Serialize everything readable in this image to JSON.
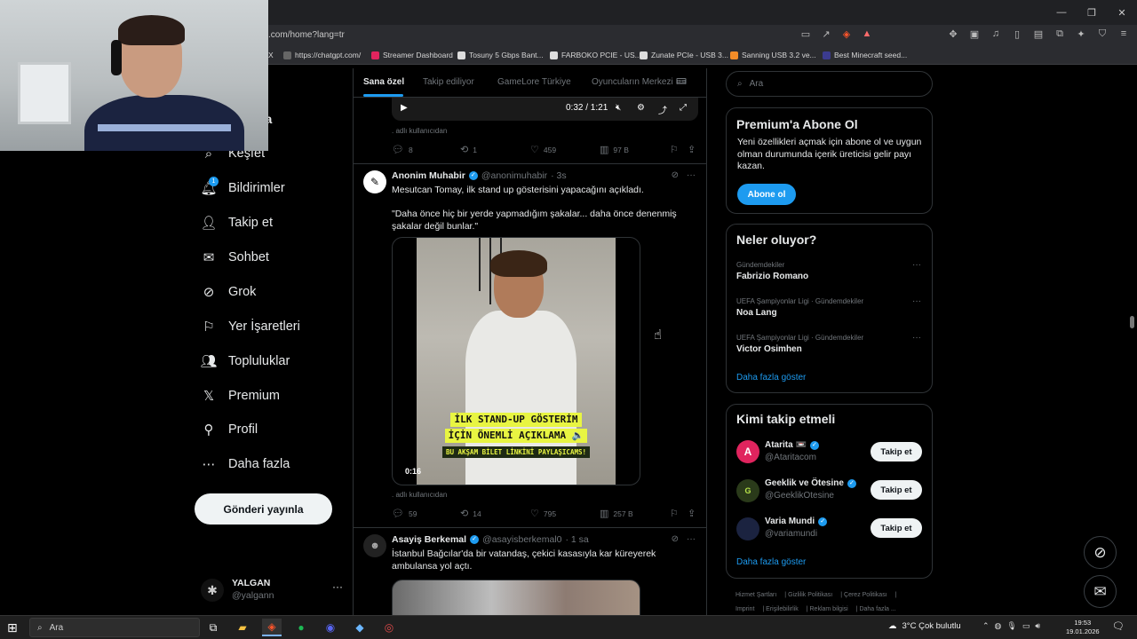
{
  "browser": {
    "url": ".com/home?lang=tr",
    "bookmarks": [
      "X",
      "https://chatgpt.com/",
      "Streamer Dashboard",
      "Tosuny 5 Gbps Bant...",
      "FARBOKO PCIE - US...",
      "Zunate PCIe - USB 3...",
      "Sanning USB 3.2 ve...",
      "Best Minecraft seed..."
    ]
  },
  "nav": {
    "partial_label": "yfa",
    "items": [
      {
        "label": "Keşfet",
        "icon": "search-icon"
      },
      {
        "label": "Bildirimler",
        "icon": "bell-icon",
        "badge": "1"
      },
      {
        "label": "Takip et",
        "icon": "person-add-icon"
      },
      {
        "label": "Sohbet",
        "icon": "mail-icon"
      },
      {
        "label": "Grok",
        "icon": "grok-icon"
      },
      {
        "label": "Yer İşaretleri",
        "icon": "bookmark-icon"
      },
      {
        "label": "Topluluklar",
        "icon": "people-icon"
      },
      {
        "label": "Premium",
        "icon": "x-logo-icon"
      },
      {
        "label": "Profil",
        "icon": "person-icon"
      },
      {
        "label": "Daha fazla",
        "icon": "more-circle-icon"
      }
    ],
    "post_button": "Gönderi yayınla",
    "account": {
      "name": "YALGAN",
      "handle": "@yalgann"
    }
  },
  "tabs": [
    "Sana özel",
    "Takip ediliyor",
    "GameLore Türkiye",
    "Oyuncuların Merkezi"
  ],
  "feed": {
    "top_video": {
      "time": "0:32 / 1:21"
    },
    "top_note": ". adlı kullanıcıdan",
    "top_actions": {
      "replies": "8",
      "reposts": "1",
      "likes": "459",
      "views": "97 B"
    },
    "tweet1": {
      "name": "Anonim Muhabir",
      "handle": "@anonimuhabir",
      "time": "· 3s",
      "text1": "Mesutcan Tomay, ilk stand up gösterisini yapacağını açıkladı.",
      "text2": "\"Daha önce hiç bir yerde yapmadığım şakalar... daha önce denenmiş şakalar değil bunlar.\"",
      "overlay_line1": "İLK STAND-UP GÖSTERİM",
      "overlay_line2": "İÇİN ÖNEMLİ AÇIKLAMA 🔈",
      "overlay_sub": "BU AKŞAM BİLET LİNKİNİ PAYLAŞICAMS!",
      "video_time": "0:16",
      "note": ". adlı kullanıcıdan",
      "actions": {
        "replies": "59",
        "reposts": "14",
        "likes": "795",
        "views": "257 B"
      }
    },
    "tweet2": {
      "name": "Asayiş Berkemal",
      "handle": "@asayisberkemal0",
      "time": "· 1 sa",
      "text": "İstanbul Bağcılar'da bir vatandaş, çekici kasasıyla kar küreyerek ambulansa yol açtı."
    }
  },
  "right": {
    "search_placeholder": "Ara",
    "premium": {
      "title": "Premium'a Abone Ol",
      "body": "Yeni özellikleri açmak için abone ol ve uygun olman durumunda içerik üreticisi gelir payı kazan.",
      "button": "Abone ol"
    },
    "trends": {
      "title": "Neler oluyor?",
      "items": [
        {
          "context": "Gündemdekiler",
          "name": "Fabrizio Romano"
        },
        {
          "context": "UEFA Şampiyonlar Ligi · Gündemdekiler",
          "name": "Noa Lang"
        },
        {
          "context": "UEFA Şampiyonlar Ligi · Gündemdekiler",
          "name": "Victor Osimhen"
        }
      ],
      "show_more": "Daha fazla göster"
    },
    "who_to_follow": {
      "title": "Kimi takip etmeli",
      "items": [
        {
          "name": "Atarita 📼",
          "handle": "@Ataritacom",
          "button": "Takip et",
          "color": "#e0245e"
        },
        {
          "name": "Geeklik ve Ötesine",
          "handle": "@GeeklikOtesine",
          "button": "Takip et",
          "color": "#2a3a1a"
        },
        {
          "name": "Varia Mundi",
          "handle": "@variamundi",
          "button": "Takip et",
          "color": "#1b2340"
        }
      ],
      "show_more": "Daha fazla göster"
    },
    "footer": [
      "Hizmet Şartları",
      "Gizlilik Politikası",
      "Çerez Politikası",
      "Imprint",
      "Erişilebilirlik",
      "Reklam bilgisi",
      "Daha fazla ..."
    ]
  },
  "taskbar": {
    "search": "Ara",
    "weather": "3°C  Çok bulutlu",
    "time": "19:53",
    "date": "19.01.2026"
  },
  "colors": {
    "accent": "#1d9bf0",
    "background": "#000000",
    "muted": "#71767b",
    "border": "#2f3336"
  }
}
